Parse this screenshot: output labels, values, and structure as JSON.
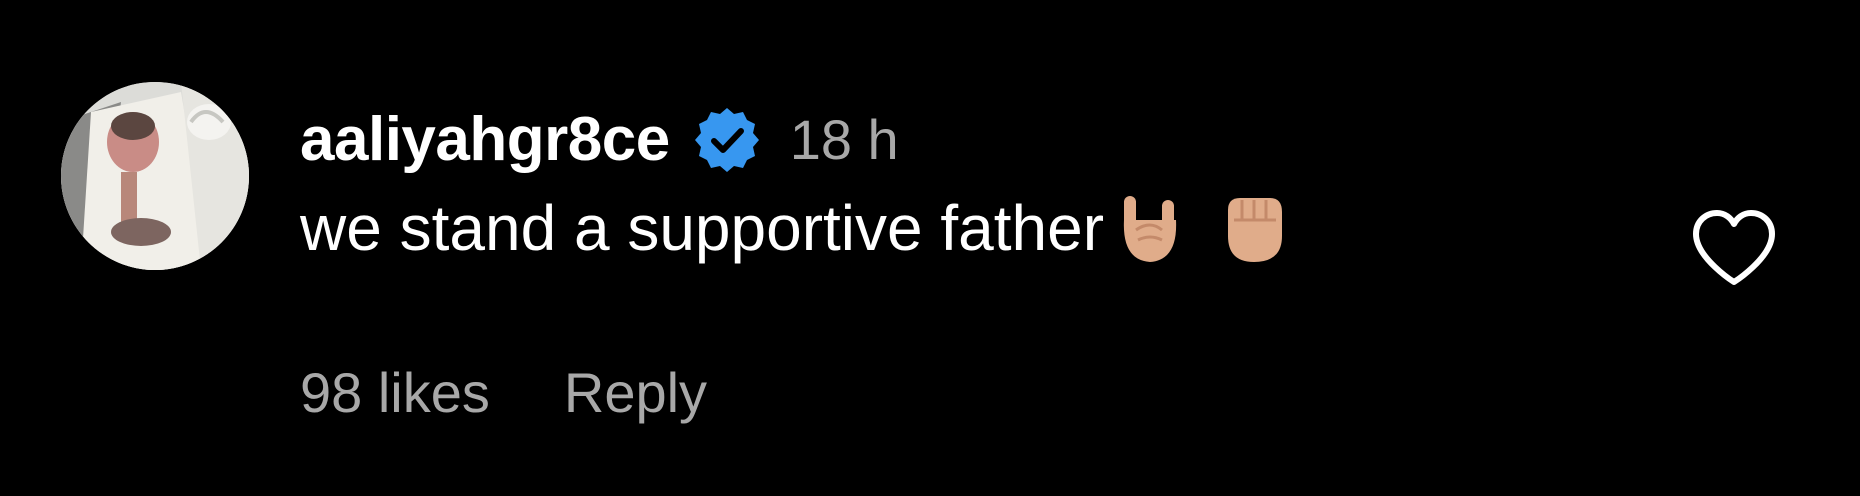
{
  "comment": {
    "username": "aaliyahgr8ce",
    "verified": true,
    "timestamp": "18 h",
    "text": "we stand a supportive father",
    "emoji_icons": [
      "sign-of-horns-emoji-icon",
      "raised-fist-emoji-icon"
    ],
    "likes_label": "98 likes",
    "reply_label": "Reply",
    "like_icon": "heart-outline-icon"
  },
  "colors": {
    "background": "#000000",
    "primary_text": "#ffffff",
    "secondary_text": "#a8a8a8",
    "verified_badge": "#3797f0",
    "emoji_skin": "#e0ac8a"
  }
}
